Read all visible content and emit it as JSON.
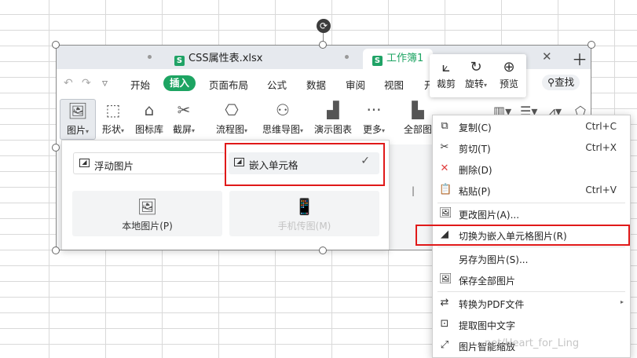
{
  "tabs": {
    "file_name": "CSS属性表.xlsx",
    "active_name": "工作簿1",
    "close_glyph": "✕",
    "add_glyph": "＋",
    "file_icon": "S",
    "active_icon": "S"
  },
  "menu": {
    "items": [
      "开始",
      "插入",
      "页面布局",
      "公式",
      "数据",
      "审阅",
      "视图",
      "开"
    ],
    "search_label": "查找"
  },
  "ribbon": {
    "buttons": [
      "图片",
      "形状",
      "图标库",
      "截屏",
      "流程图",
      "思维导图",
      "演示图表",
      "更多",
      "全部图"
    ]
  },
  "image_toolbar": {
    "crop_label": "裁剪",
    "rotate_label": "旋转",
    "preview_label": "预览"
  },
  "picture_dropdown": {
    "float_label": "浮动图片",
    "embed_label": "嵌入单元格",
    "local_label": "本地图片(P)",
    "phone_label": "手机传图(M)"
  },
  "context_menu": {
    "items": [
      {
        "label": "复制(C)",
        "shortcut": "Ctrl+C",
        "icon": "copy-icon"
      },
      {
        "label": "剪切(T)",
        "shortcut": "Ctrl+X",
        "icon": "cut-icon"
      },
      {
        "label": "删除(D)",
        "shortcut": "",
        "icon": "delete-icon"
      },
      {
        "label": "粘贴(P)",
        "shortcut": "Ctrl+V",
        "icon": "paste-icon"
      },
      {
        "label": "更改图片(A)...",
        "shortcut": "",
        "icon": "change-picture-icon"
      },
      {
        "label": "切换为嵌入单元格图片(R)",
        "shortcut": "",
        "icon": "embed-cell-icon"
      },
      {
        "label": "另存为图片(S)...",
        "shortcut": "",
        "icon": ""
      },
      {
        "label": "保存全部图片",
        "shortcut": "",
        "icon": "save-all-icon"
      },
      {
        "label": "转换为PDF文件",
        "shortcut": "",
        "icon": "pdf-icon"
      },
      {
        "label": "提取图中文字",
        "shortcut": "",
        "icon": "extract-text-icon"
      },
      {
        "label": "图片智能缩放",
        "shortcut": "",
        "icon": "smart-zoom-icon"
      }
    ]
  },
  "watermark": "net/Heart_for_Ling",
  "colors": {
    "accent_green": "#1da462",
    "highlight_red": "#e01919",
    "delete_red": "#e04040"
  }
}
